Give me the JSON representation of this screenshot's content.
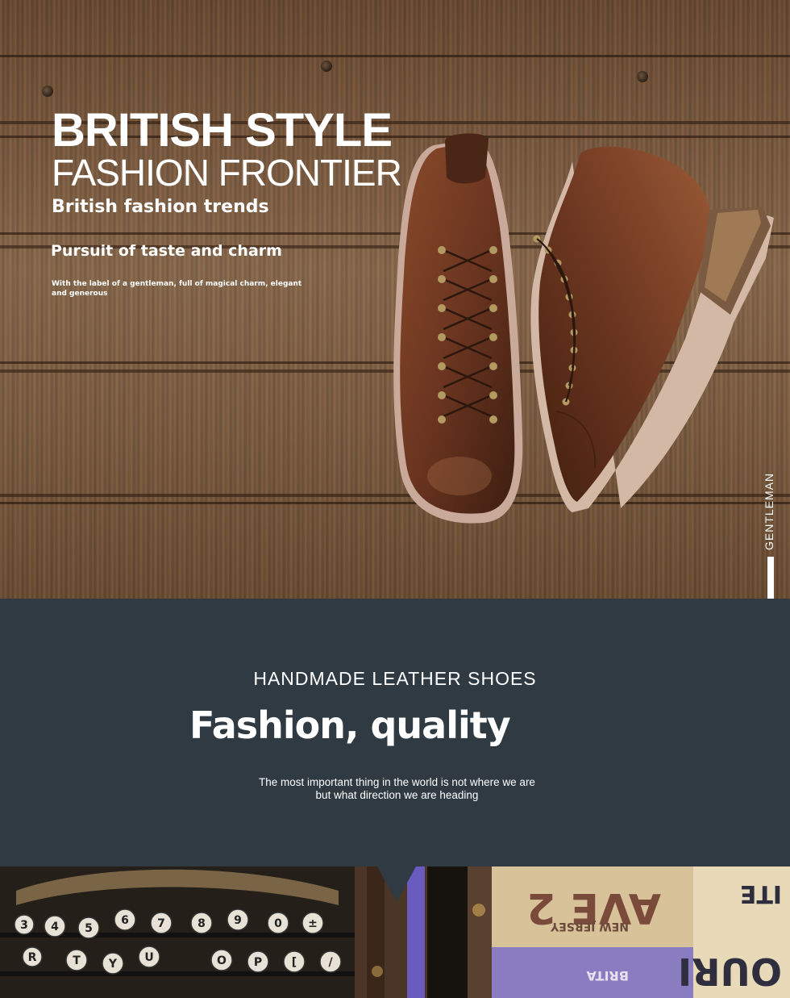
{
  "hero": {
    "title": "BRITISH STYLE",
    "subtitle": "FASHION FRONTIER",
    "line1": "British fashion trends",
    "line2": "Pursuit of taste and charm",
    "small_text": "With the label of a gentleman, full of magical charm, elegant and generous",
    "vertical_label": "GENTLEMAN"
  },
  "band": {
    "kicker": "HANDMADE LEATHER SHOES",
    "title": "Fashion, quality",
    "quote_line1": "The most important thing in the world is not where we are",
    "quote_line2": "but what direction we are heading"
  },
  "strip": {
    "keys_row1": [
      "3",
      "4",
      "5",
      "6",
      "7",
      "8",
      "9",
      "0",
      "±"
    ],
    "keys_row2": [
      "R",
      "T",
      "Y",
      "U",
      "O",
      "P",
      "[",
      "/"
    ],
    "sign_text_1": "AVE 2",
    "sign_text_2": "NEW JERSEY",
    "sign_text_3": "OURI",
    "sign_text_4": "ITE",
    "sign_text_5": "BRITA"
  },
  "colors": {
    "slate": "#2f3a43",
    "wood": "#7c5b40",
    "leather": "#6b3a22",
    "white": "#ffffff"
  }
}
